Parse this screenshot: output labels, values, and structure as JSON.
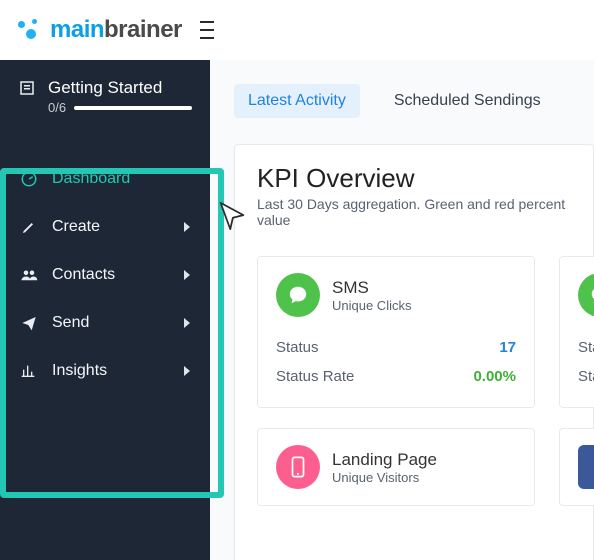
{
  "brand": {
    "main": "main",
    "brainer": "brainer"
  },
  "sidebar": {
    "gettingStarted": {
      "title": "Getting Started",
      "progress": "0/6"
    },
    "items": [
      {
        "label": "Dashboard"
      },
      {
        "label": "Create"
      },
      {
        "label": "Contacts"
      },
      {
        "label": "Send"
      },
      {
        "label": "Insights"
      }
    ]
  },
  "tabs": {
    "latest": "Latest Activity",
    "scheduled": "Scheduled Sendings"
  },
  "kpi": {
    "title": "KPI Overview",
    "subtitle": "Last 30 Days aggregation. Green and red percent value"
  },
  "cards": {
    "sms": {
      "title": "SMS",
      "sub": "Unique Clicks",
      "status_k": "Status",
      "status_v": "17",
      "rate_k": "Status Rate",
      "rate_v": "0.00%"
    },
    "sms2": {
      "status_k": "Status"
    },
    "lp": {
      "title": "Landing Page",
      "sub": "Unique Visitors"
    }
  }
}
